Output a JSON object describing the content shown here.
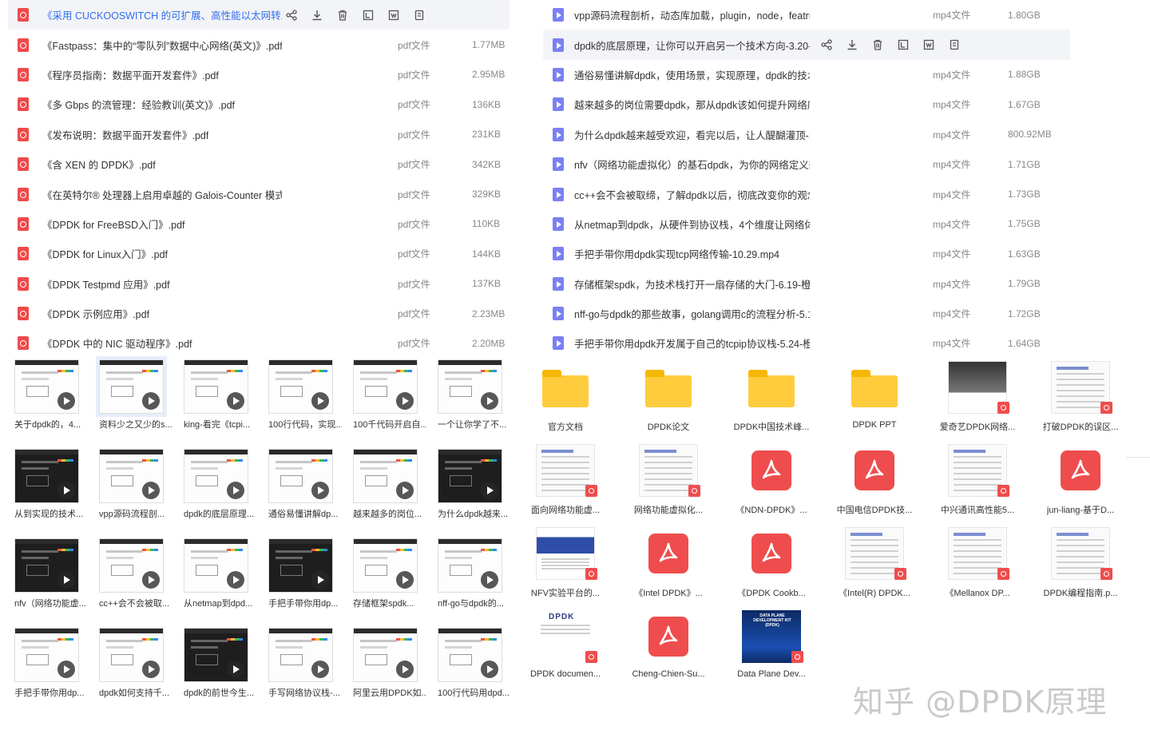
{
  "left_files": [
    {
      "name": "《采用 CUCKOOSWITCH 的可扩展、高性能以太网转发(...",
      "type": "",
      "size": "",
      "selected": true
    },
    {
      "name": "《Fastpass：集中的“零队列”数据中心网络(英文)》.pdf",
      "type": "pdf文件",
      "size": "1.77MB"
    },
    {
      "name": "《程序员指南：数据平面开发套件》.pdf",
      "type": "pdf文件",
      "size": "2.95MB"
    },
    {
      "name": "《多 Gbps 的流管理：经验教训(英文)》.pdf",
      "type": "pdf文件",
      "size": "136KB"
    },
    {
      "name": "《发布说明：数据平面开发套件》.pdf",
      "type": "pdf文件",
      "size": "231KB"
    },
    {
      "name": "《含 XEN 的 DPDK》.pdf",
      "type": "pdf文件",
      "size": "342KB"
    },
    {
      "name": "《在英特尔® 处理器上启用卓越的 Galois-Counter 模式...",
      "type": "pdf文件",
      "size": "329KB"
    },
    {
      "name": "《DPDK for FreeBSD入门》.pdf",
      "type": "pdf文件",
      "size": "110KB"
    },
    {
      "name": "《DPDK for Linux入门》.pdf",
      "type": "pdf文件",
      "size": "144KB"
    },
    {
      "name": "《DPDK Testpmd 应用》.pdf",
      "type": "pdf文件",
      "size": "137KB"
    },
    {
      "name": "《DPDK 示例应用》.pdf",
      "type": "pdf文件",
      "size": "2.23MB"
    },
    {
      "name": "《DPDK 中的 NIC 驱动程序》.pdf",
      "type": "pdf文件",
      "size": "2.20MB"
    }
  ],
  "right_files": [
    {
      "name": "vpp源码流程剖析，动态库加载，plugin，node，featru...",
      "type": "mp4文件",
      "size": "1.80GB"
    },
    {
      "name": "dpdk的底层原理，让你可以开启另一个技术方向-3.20-...",
      "type": "",
      "size": "",
      "hovered": true
    },
    {
      "name": "通俗易懂讲解dpdk，使用场景，实现原理，dpdk的技术...",
      "type": "mp4文件",
      "size": "1.88GB"
    },
    {
      "name": "越来越多的岗位需要dpdk，那从dpdk该如何提升网络底...",
      "type": "mp4文件",
      "size": "1.67GB"
    },
    {
      "name": "为什么dpdk越来越受欢迎，看完以后，让人醍醐灌顶-1....",
      "type": "mp4文件",
      "size": "800.92MB"
    },
    {
      "name": "nfv（网络功能虚拟化）的基石dpdk，为你的网络定义新...",
      "type": "mp4文件",
      "size": "1.71GB"
    },
    {
      "name": "cc++会不会被取缔，了解dpdk以后，彻底改变你的观念...",
      "type": "mp4文件",
      "size": "1.73GB"
    },
    {
      "name": "从netmap到dpdk，从硬件到协议栈，4个维度让网络体...",
      "type": "mp4文件",
      "size": "1.75GB"
    },
    {
      "name": "手把手带你用dpdk实现tcp网络传输-10.29.mp4",
      "type": "mp4文件",
      "size": "1.63GB"
    },
    {
      "name": "存储框架spdk，为技术栈打开一扇存储的大门-6.19-橙子...",
      "type": "mp4文件",
      "size": "1.79GB"
    },
    {
      "name": "nff-go与dpdk的那些故事，golang调用c的流程分析-5.1...",
      "type": "mp4文件",
      "size": "1.72GB"
    },
    {
      "name": "手把手带你用dpdk开发属于自己的tcpip协议栈-5.24-橙...",
      "type": "mp4文件",
      "size": "1.64GB"
    }
  ],
  "row_actions": [
    "share-icon",
    "download-icon",
    "delete-icon",
    "rename-icon",
    "move-icon",
    "more-icon"
  ],
  "videos": [
    {
      "label": "关于dpdk的，4...",
      "dark": false
    },
    {
      "label": "资料少之又少的s...",
      "dark": false,
      "selected": true
    },
    {
      "label": "king-看完《tcpi...",
      "dark": false
    },
    {
      "label": "100行代码，实现...",
      "dark": false
    },
    {
      "label": "100千代码开启自...",
      "dark": false
    },
    {
      "label": "一个让你学了不...",
      "dark": false
    },
    {
      "label": "从到实现的技术...",
      "dark": true
    },
    {
      "label": "vpp源码流程剖...",
      "dark": false
    },
    {
      "label": "dpdk的底层原理...",
      "dark": false
    },
    {
      "label": "通俗易懂讲解dp...",
      "dark": false
    },
    {
      "label": "越来越多的岗位...",
      "dark": false
    },
    {
      "label": "为什么dpdk越来...",
      "dark": true
    },
    {
      "label": "nfv（网络功能虚...",
      "dark": true
    },
    {
      "label": "cc++会不会被取...",
      "dark": false
    },
    {
      "label": "从netmap到dpd...",
      "dark": false
    },
    {
      "label": "手把手带你用dp...",
      "dark": true
    },
    {
      "label": "存储框架spdk...",
      "dark": false
    },
    {
      "label": "nff-go与dpdk的...",
      "dark": false
    },
    {
      "label": "手把手带你用dp...",
      "dark": false
    },
    {
      "label": "dpdk如何支持千...",
      "dark": false
    },
    {
      "label": "dpdk的前世今生...",
      "dark": true
    },
    {
      "label": "手写网络协议栈-...",
      "dark": false
    },
    {
      "label": "阿里云用DPDK如...",
      "dark": false
    },
    {
      "label": "100行代码用dpd...",
      "dark": false
    }
  ],
  "docs": [
    {
      "label": "官方文档",
      "kind": "folder"
    },
    {
      "label": "DPDK论文",
      "kind": "folder"
    },
    {
      "label": "DPDK中国技术峰...",
      "kind": "folder"
    },
    {
      "label": "DPDK  PPT",
      "kind": "folder"
    },
    {
      "label": "爱奇艺DPDK网络...",
      "kind": "photo"
    },
    {
      "label": "打破DPDK的误区...",
      "kind": "paper"
    },
    {
      "label": "面向网络功能虚...",
      "kind": "paper"
    },
    {
      "label": "网络功能虚拟化...",
      "kind": "paper"
    },
    {
      "label": "《NDN-DPDK》...",
      "kind": "pdf"
    },
    {
      "label": "中国电信DPDK技...",
      "kind": "pdf"
    },
    {
      "label": "中兴通讯高性能5...",
      "kind": "paper"
    },
    {
      "label": "jun-liang-基于D...",
      "kind": "pdf"
    },
    {
      "label": "NFV实验平台的...",
      "kind": "nfv"
    },
    {
      "label": "《Intel DPDK》...",
      "kind": "pdf"
    },
    {
      "label": "《DPDK Cookb...",
      "kind": "pdf"
    },
    {
      "label": "《Intel(R) DPDK...",
      "kind": "paper"
    },
    {
      "label": "《Mellanox DP...",
      "kind": "paper"
    },
    {
      "label": "DPDK编程指南.p...",
      "kind": "paper"
    },
    {
      "label": "DPDK documen...",
      "kind": "dpdkdoc",
      "logo": "DPDK"
    },
    {
      "label": "Cheng-Chien-Su...",
      "kind": "pdf"
    },
    {
      "label": "Data Plane Dev...",
      "kind": "dp",
      "cover": "DATA PLANE DEVELOPMENT KIT (DPDK)"
    }
  ],
  "watermark": "知乎 @DPDK原理",
  "colors": {
    "pdf": "#ee4a4a",
    "mp4": "#7b80f2",
    "folder": "#ffcc3d",
    "selected_text": "#2f6df3",
    "hover_bg": "#f3f4f7"
  }
}
